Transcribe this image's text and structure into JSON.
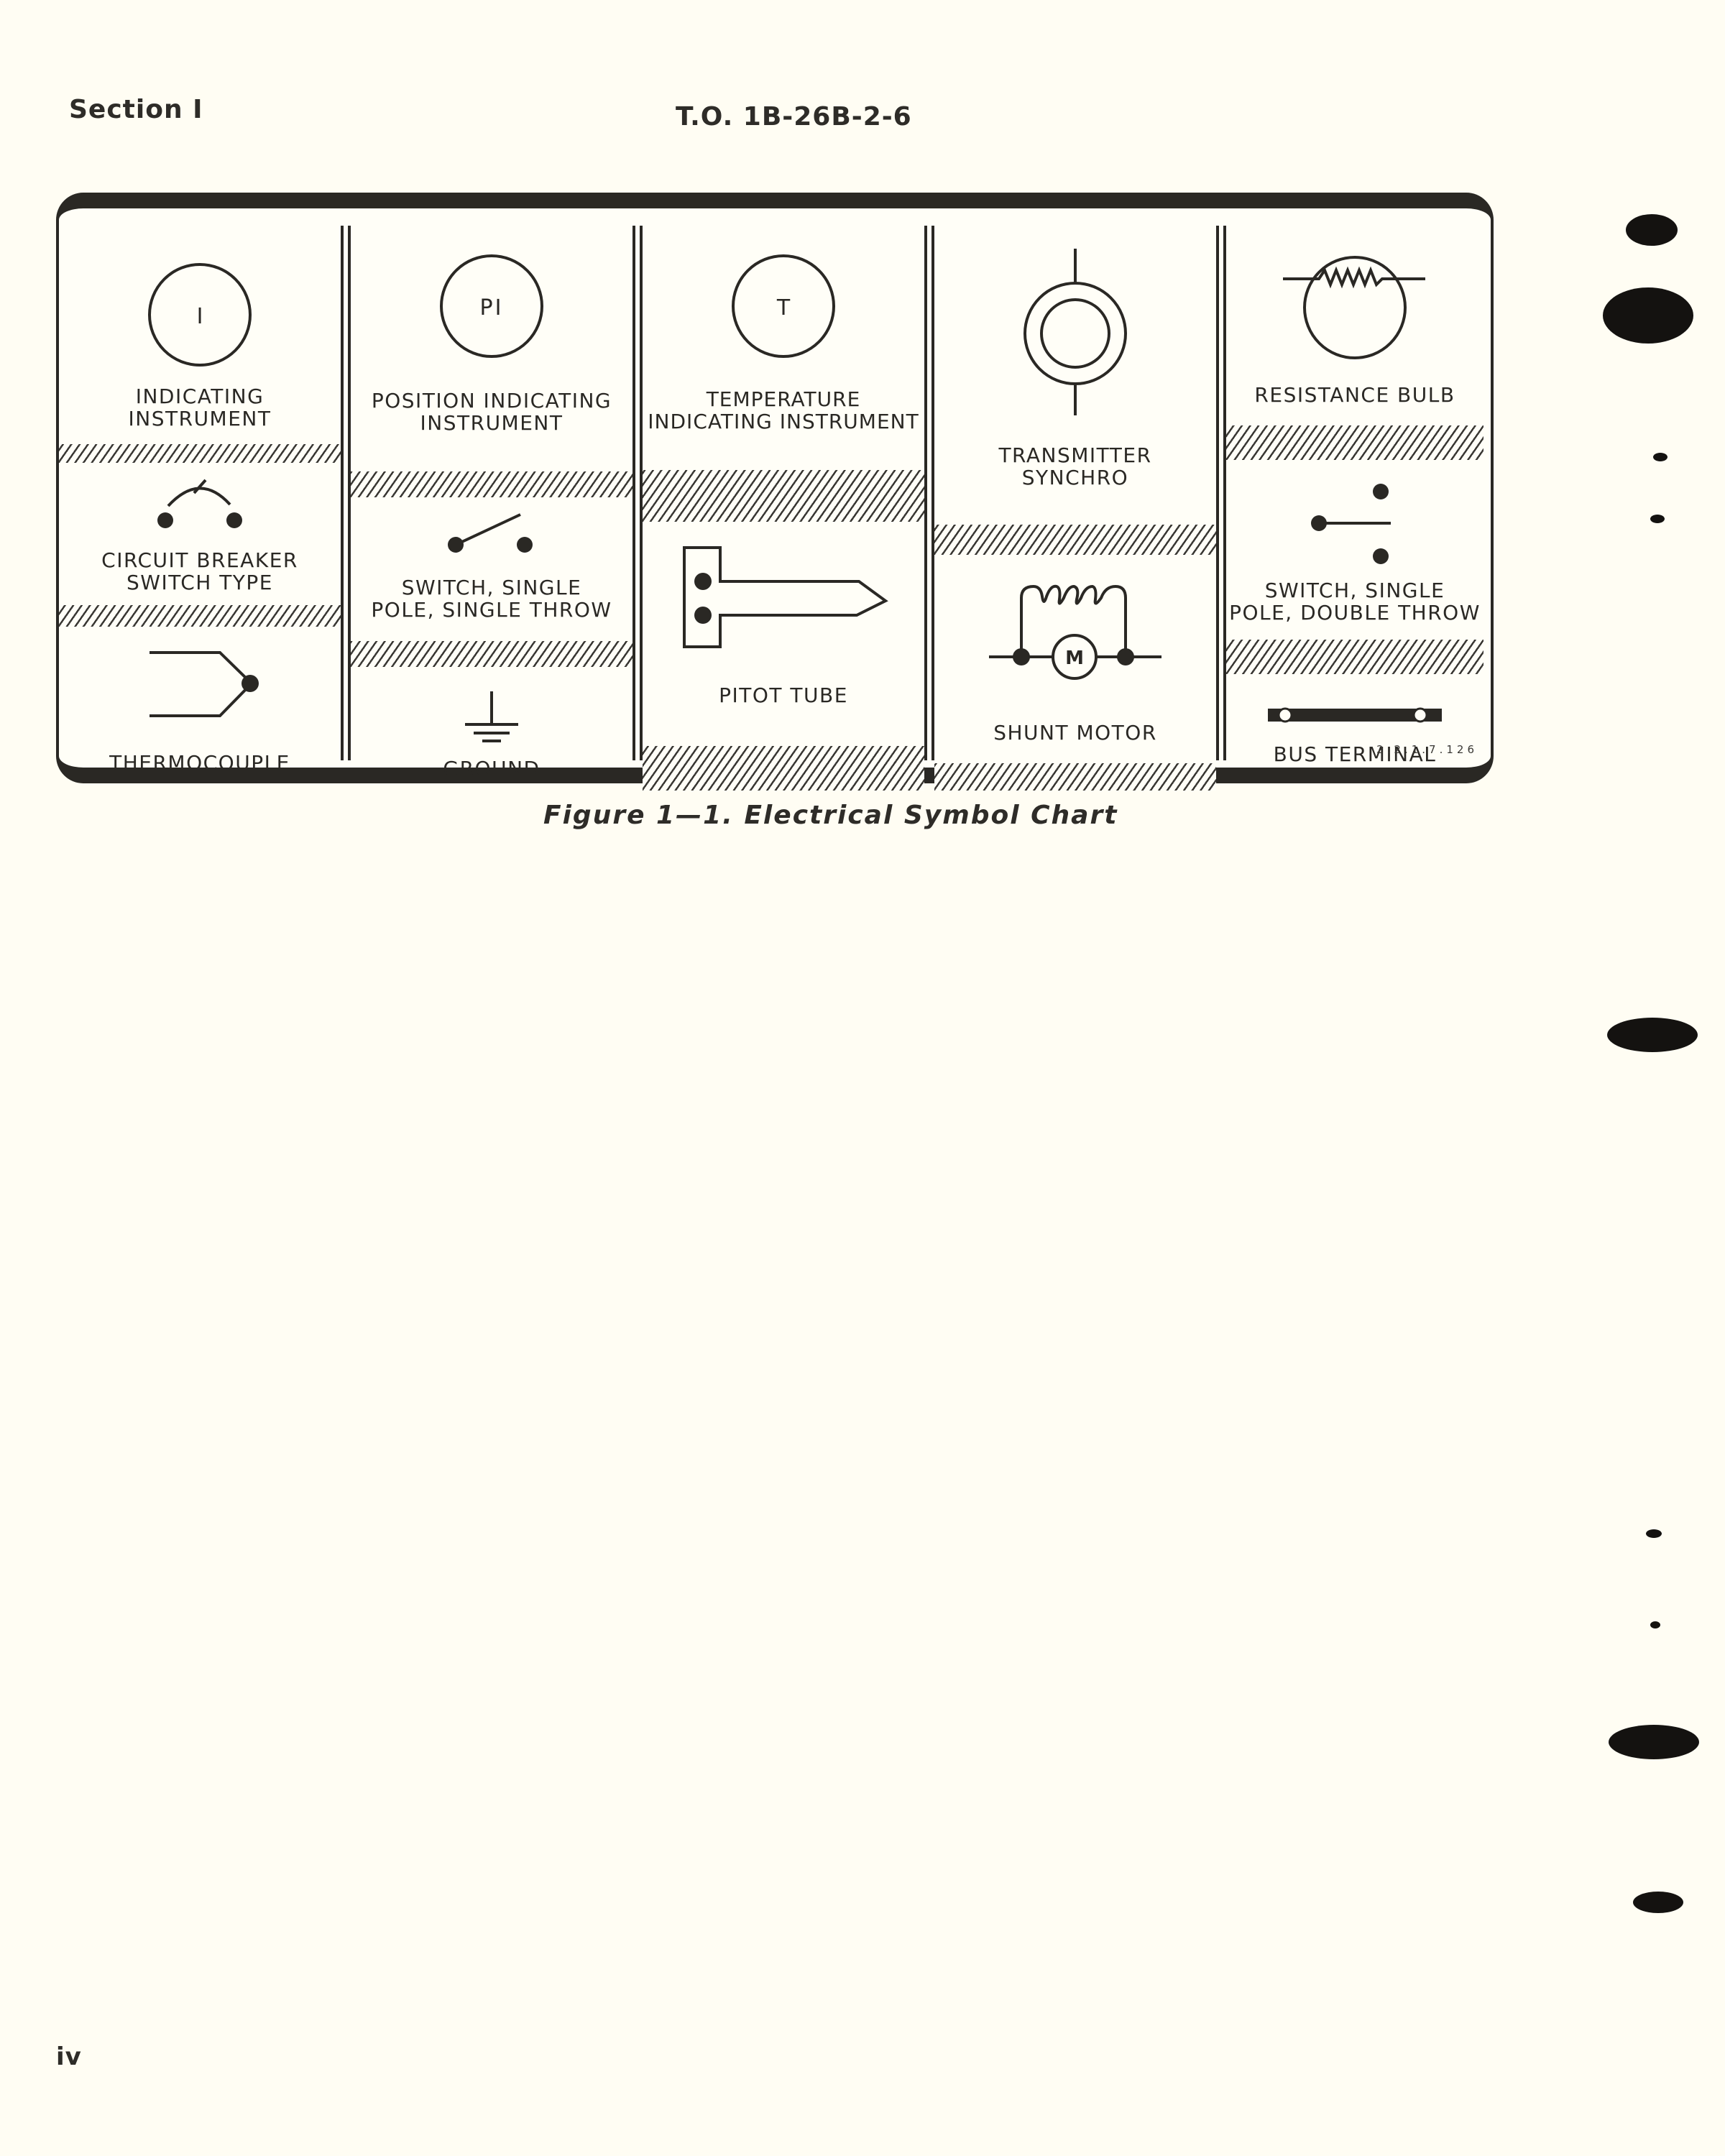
{
  "header": {
    "section": "Section I",
    "to_number": "T.O. 1B-26B-2-6"
  },
  "chart": {
    "figure_code": "2.2.1.7.126",
    "columns": [
      {
        "cells": [
          {
            "symbol": "indicating-instrument",
            "glyph_text": "I",
            "label": "INDICATING\nINSTRUMENT"
          },
          {
            "symbol": "circuit-breaker",
            "label": "CIRCUIT BREAKER\nSWITCH TYPE"
          },
          {
            "symbol": "thermocouple",
            "label": "THERMOCOUPLE"
          }
        ]
      },
      {
        "cells": [
          {
            "symbol": "position-indicating-instrument",
            "glyph_text": "PI",
            "label": "POSITION INDICATING\nINSTRUMENT"
          },
          {
            "symbol": "switch-spst",
            "label": "SWITCH, SINGLE\nPOLE, SINGLE THROW"
          },
          {
            "symbol": "ground",
            "label": "GROUND"
          }
        ]
      },
      {
        "cells": [
          {
            "symbol": "temperature-indicating-instrument",
            "glyph_text": "T",
            "label": "TEMPERATURE\nINDICATING INSTRUMENT"
          },
          {
            "symbol": "pitot-tube",
            "label": "PITOT TUBE"
          }
        ]
      },
      {
        "cells": [
          {
            "symbol": "transmitter-synchro",
            "label": "TRANSMITTER\nSYNCHRO"
          },
          {
            "symbol": "shunt-motor",
            "glyph_text": "M",
            "label": "SHUNT MOTOR"
          }
        ]
      },
      {
        "cells": [
          {
            "symbol": "resistance-bulb",
            "label": "RESISTANCE BULB"
          },
          {
            "symbol": "switch-spdt",
            "label": "SWITCH, SINGLE\nPOLE, DOUBLE THROW"
          },
          {
            "symbol": "bus-terminal",
            "label": "BUS TERMINAL"
          }
        ]
      }
    ]
  },
  "caption": "Figure 1—1.  Electrical Symbol Chart",
  "footer": {
    "page_number": "iv"
  }
}
